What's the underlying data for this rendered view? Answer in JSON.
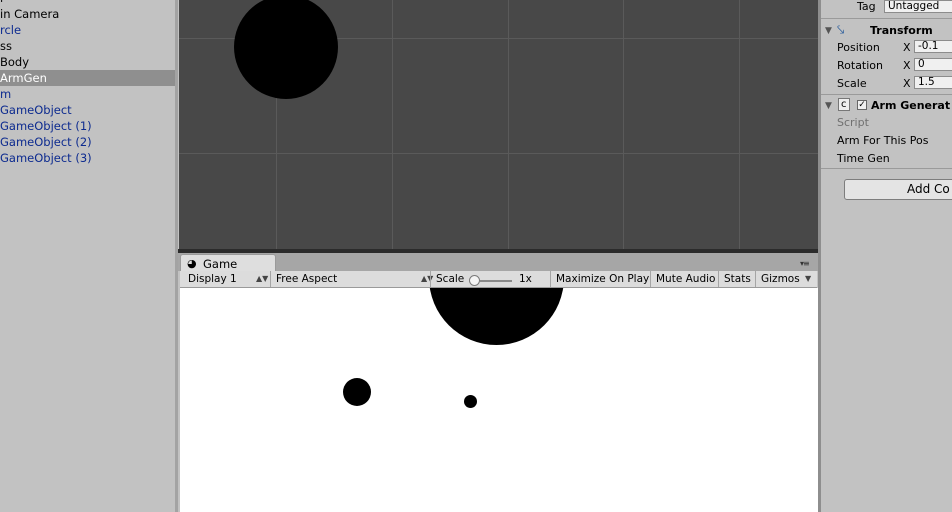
{
  "hierarchy": {
    "items": [
      {
        "label": "l"
      },
      {
        "label": "in Camera"
      },
      {
        "label": "rcle"
      },
      {
        "label": "ss"
      },
      {
        "label": "Body"
      },
      {
        "label": "ArmGen"
      },
      {
        "label": "m"
      },
      {
        "label": "GameObject"
      },
      {
        "label": "GameObject (1)"
      },
      {
        "label": "GameObject (2)"
      },
      {
        "label": "GameObject (3)"
      }
    ]
  },
  "game": {
    "tab_label": "Game",
    "display": "Display 1",
    "aspect": "Free Aspect",
    "scale_label": "Scale",
    "scale_value": "1x",
    "maximize_on_play": "Maximize On Play",
    "mute_audio": "Mute Audio",
    "stats": "Stats",
    "gizmos": "Gizmos"
  },
  "inspector": {
    "tag_label": "Tag",
    "tag_value": "Untagged",
    "transform": {
      "title": "Transform",
      "position_label": "Position",
      "position_x": "-0.1",
      "rotation_label": "Rotation",
      "rotation_x": "0",
      "scale_label": "Scale",
      "scale_x": "1.5",
      "axis_x": "X"
    },
    "component": {
      "title": "Arm Generat",
      "script_label": "Script",
      "field1": "Arm For This Pos",
      "field2": "Time Gen"
    },
    "add_component": "Add Co"
  }
}
